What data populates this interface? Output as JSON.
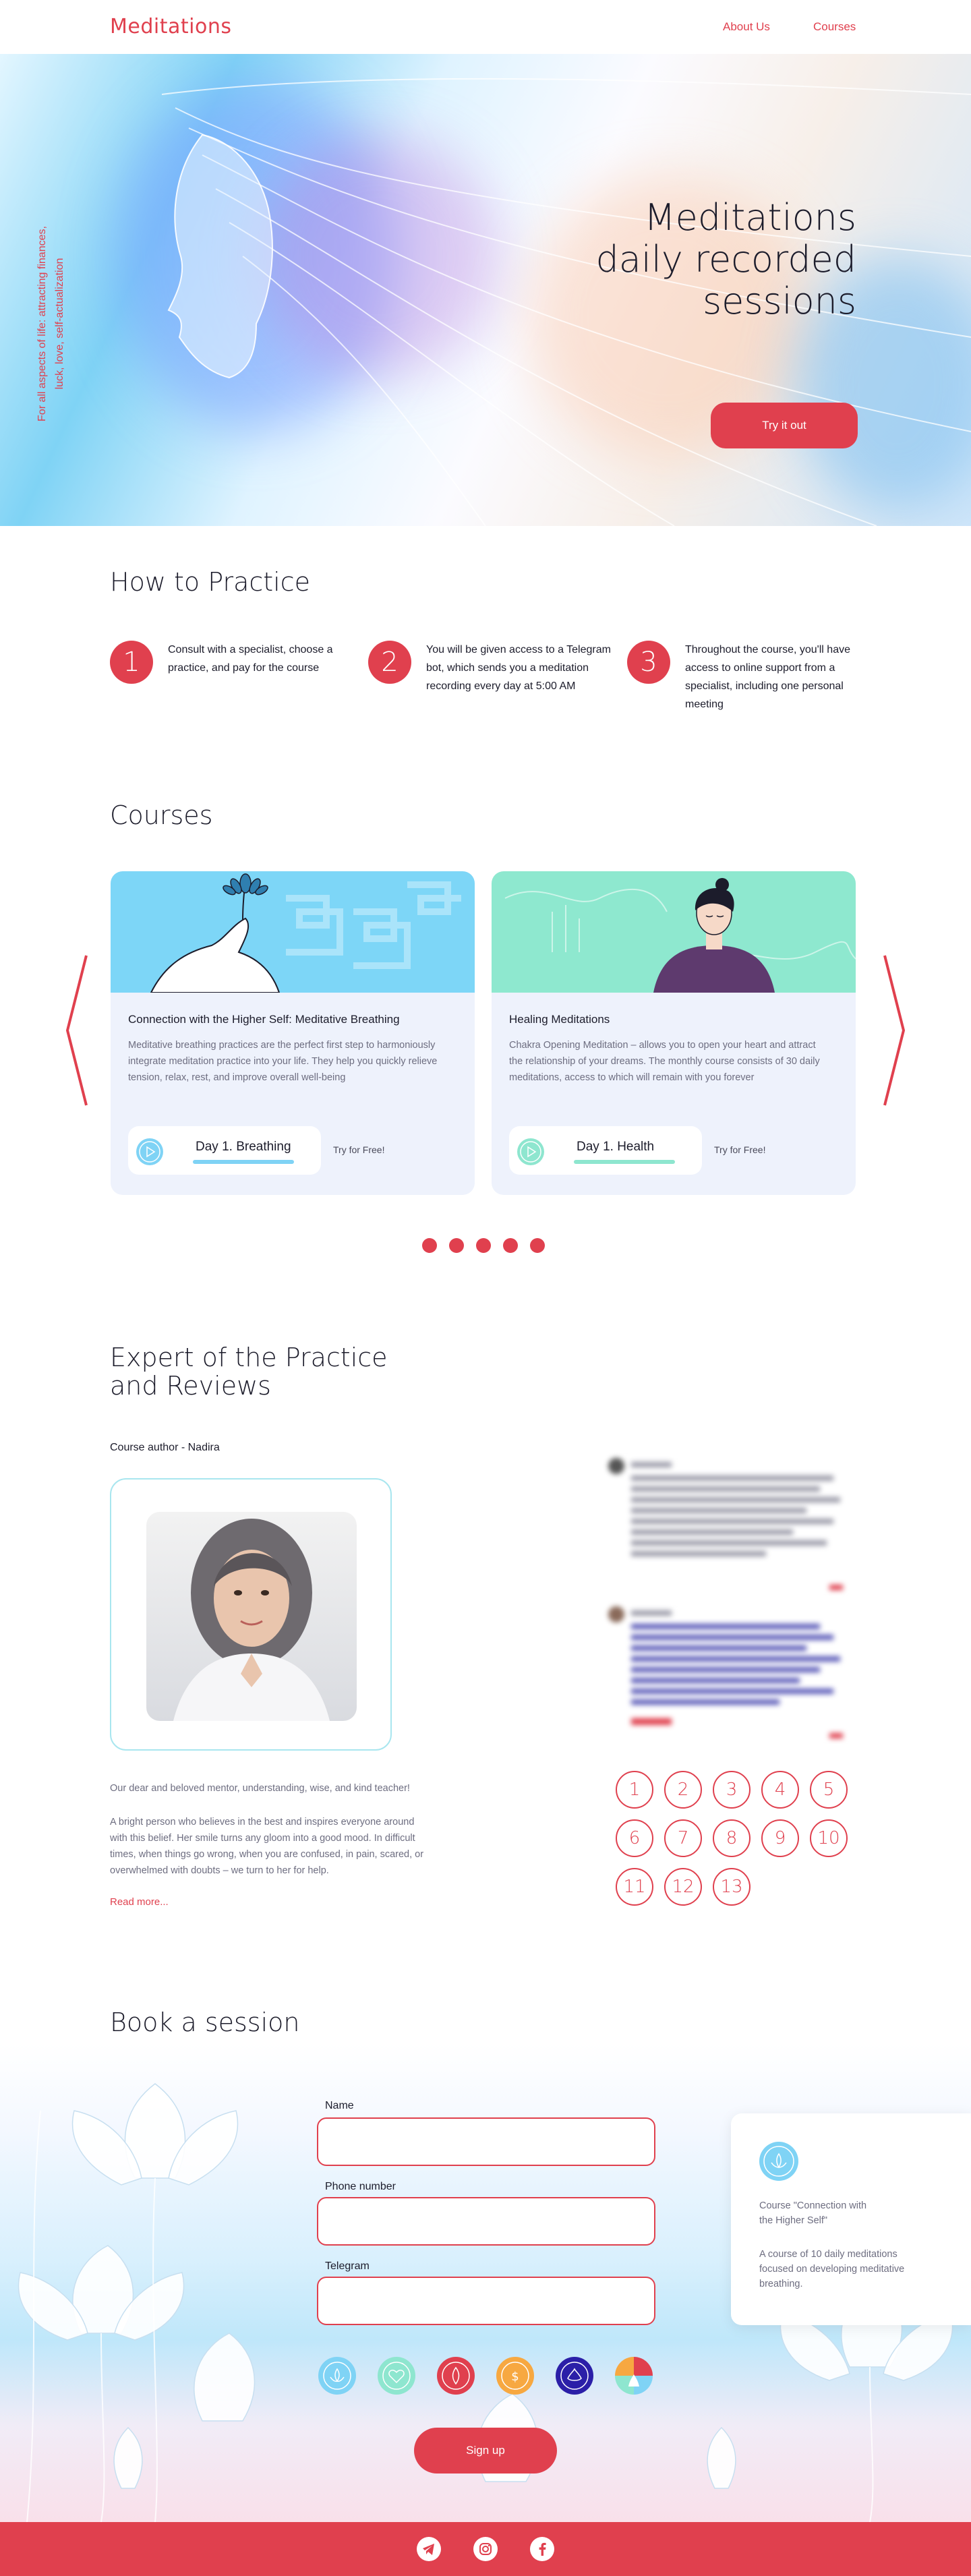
{
  "header": {
    "logo": "Meditations",
    "nav": [
      "About Us",
      "Courses"
    ]
  },
  "hero": {
    "title": "Meditations\ndaily recorded\nsessions",
    "side_text": "For all aspects of life: attracting finances,\nluck, love, self-actualization",
    "cta": "Try it out"
  },
  "how": {
    "title": "How to Practice",
    "steps": [
      {
        "num": "1",
        "text": "Consult with a specialist, choose a practice, and pay for the course"
      },
      {
        "num": "2",
        "text": "You will be given access to a Telegram bot, which sends you a meditation recording every day at 5:00 AM"
      },
      {
        "num": "3",
        "text": "Throughout the course, you'll have access to online support from a specialist, including one personal meeting"
      }
    ]
  },
  "courses": {
    "title": "Courses",
    "cards": [
      {
        "title": "Connection with the Higher Self: Meditative Breathing",
        "desc": "Meditative breathing practices are the perfect first step to harmoniously integrate meditation practice into your life. They help you quickly relieve tension, relax, rest, and improve overall well-being",
        "player_title": "Day 1. Breathing",
        "try": "Try for Free!",
        "accent": "#7fd3f5"
      },
      {
        "title": "Healing Meditations",
        "desc": "Chakra Opening Meditation – allows you to open your heart and attract the relationship of your dreams. The monthly course consists of 30 daily meditations, access to which will remain with you forever",
        "player_title": "Day 1. Health",
        "try": "Try for Free!",
        "accent": "#8ee6cf"
      }
    ],
    "dots": 5
  },
  "expert": {
    "title": "Expert of the Practice\nand Reviews",
    "author": "Course author - Nadira",
    "intro": "Our dear and beloved mentor, understanding, wise, and kind teacher!",
    "bio": "A bright person who believes in the best and inspires everyone around with this belief. Her smile turns any gloom into a good mood. In difficult times, when things go wrong, when you are confused, in pain, scared, or overwhelmed with doubts – we turn to her for help.",
    "read_more": "Read more...",
    "pages": [
      "1",
      "2",
      "3",
      "4",
      "5",
      "6",
      "7",
      "8",
      "9",
      "10",
      "11",
      "12",
      "13"
    ]
  },
  "booking": {
    "title": "Book a session",
    "fields": [
      {
        "label": "Name",
        "value": ""
      },
      {
        "label": "Phone number",
        "value": ""
      },
      {
        "label": "Telegram",
        "value": ""
      }
    ],
    "submit": "Sign up",
    "info": {
      "course": "Course \"Connection with\nthe Higher Self\"",
      "desc": "A course of 10 daily meditations\nfocused on developing meditative\nbreathing."
    }
  },
  "footer": {
    "social": [
      "telegram-icon",
      "instagram-icon",
      "facebook-icon"
    ]
  },
  "colors": {
    "accent": "#e0404e",
    "light_blue": "#7fd3f5",
    "mint": "#8ee6cf"
  }
}
